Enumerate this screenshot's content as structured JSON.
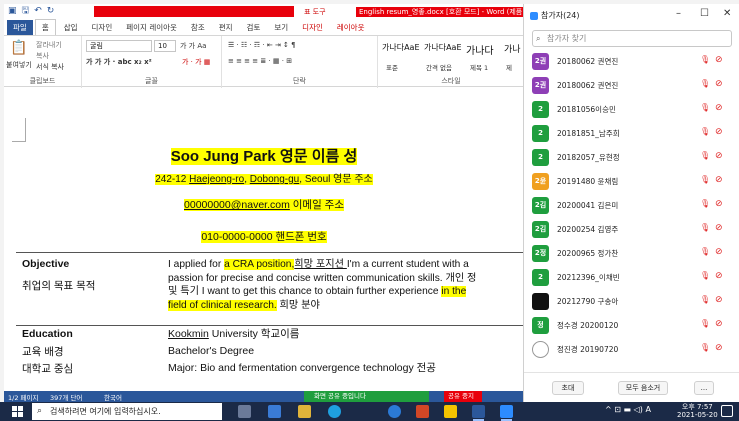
{
  "word": {
    "doc_title": "English resum_영좋.docx [호환 모드] - Word (제품",
    "context_tool": "표 도구",
    "tabs": [
      "파일",
      "홈",
      "삽입",
      "디자인",
      "페이지 레이아웃",
      "참조",
      "편지",
      "검토",
      "보기",
      "디자인",
      "레이아웃"
    ],
    "ribbon": {
      "paste": "붙여넣기",
      "cut": "잘라내기",
      "copy": "복사",
      "format_painter": "서식 복사",
      "clipboard_label": "클립보드",
      "font_name": "굴림",
      "font_size": "10",
      "font_label": "글꼴",
      "paragraph_label": "단락",
      "styles": [
        "가나다AaE",
        "가나다AaE",
        "가나다",
        "가나"
      ],
      "style_names": [
        "표준",
        "간격 없음",
        "제목 1",
        "제"
      ],
      "styles_label": "스타일"
    },
    "document": {
      "name_en": "Soo Jung Park",
      "name_ko": "영문 이름 성",
      "address_num": "242-12",
      "address_street": "Haejeong-ro",
      "address_district": "Dobong-gu",
      "address_city": "Seoul",
      "address_label": "영문 주소",
      "email": "00000000@naver.com",
      "email_label": "이메일 주소",
      "phone": "010-0000-0000",
      "phone_label": "핸드폰 번호",
      "objective_label": "Objective",
      "objective_ko": "취업의 목표 목적",
      "objective_lines": [
        [
          "I applied for ",
          "a CRA position,",
          "희망 포지션 ",
          "I'm a current student with a"
        ],
        [
          "passion for precise and concise written communication skills. 개인 정"
        ],
        [
          "및 특기 ",
          "I want to get this chance to obtain further experience ",
          "in the"
        ],
        [
          "field of clinical research.",
          " 희망 분야"
        ]
      ],
      "education_label": "Education",
      "education_ko1": "교육 배경",
      "education_ko2": "대학교 중심",
      "edu_school": "Kookmin",
      "edu_school_rest": " University 학교이름",
      "edu_degree": "Bachelor's Degree",
      "edu_major": "Major: Bio and fermentation convergence technology 전공"
    },
    "status": {
      "page": "1/2 페이지",
      "words": "397개 단어",
      "lang": "한국어",
      "sharing": "화면 공유 중입니다",
      "stop_share": "공유 중지"
    }
  },
  "participants": {
    "title": "참가자(24)",
    "search_placeholder": "참가자 찾기",
    "list": [
      {
        "avatar": "2권",
        "color": "#8e3fb6",
        "name": "20180062 권연진"
      },
      {
        "avatar": "2권",
        "color": "#8e3fb6",
        "name": "20180062 권연진"
      },
      {
        "avatar": "2",
        "color": "#1f9e3e",
        "name": "20181056이승민"
      },
      {
        "avatar": "2",
        "color": "#1f9e3e",
        "name": "20181851_남주희"
      },
      {
        "avatar": "2",
        "color": "#1f9e3e",
        "name": "20182057_유현정"
      },
      {
        "avatar": "2윤",
        "color": "#f0a020",
        "name": "20191480 윤채림"
      },
      {
        "avatar": "2김",
        "color": "#1f9e3e",
        "name": "20200041 김은미"
      },
      {
        "avatar": "2김",
        "color": "#1f9e3e",
        "name": "20200254 김영주"
      },
      {
        "avatar": "2정",
        "color": "#1f9e3e",
        "name": "20200965 정가찬"
      },
      {
        "avatar": "2",
        "color": "#1f9e3e",
        "name": "20212396_이채빈"
      },
      {
        "avatar": "",
        "color": "#111111",
        "name": "20212790 구송아"
      },
      {
        "avatar": "정",
        "color": "#1f9e3e",
        "name": "정수경 20200120"
      },
      {
        "avatar": "",
        "color": "#ffffff",
        "name": "정진경 20190720"
      }
    ],
    "invite": "초대",
    "mute_all": "모두 음소거",
    "more": "..."
  },
  "taskbar": {
    "search_placeholder": "검색하려면 여기에 입력하십시오.",
    "time": "오후 7:57",
    "date": "2021-05-20",
    "ime": "A"
  }
}
